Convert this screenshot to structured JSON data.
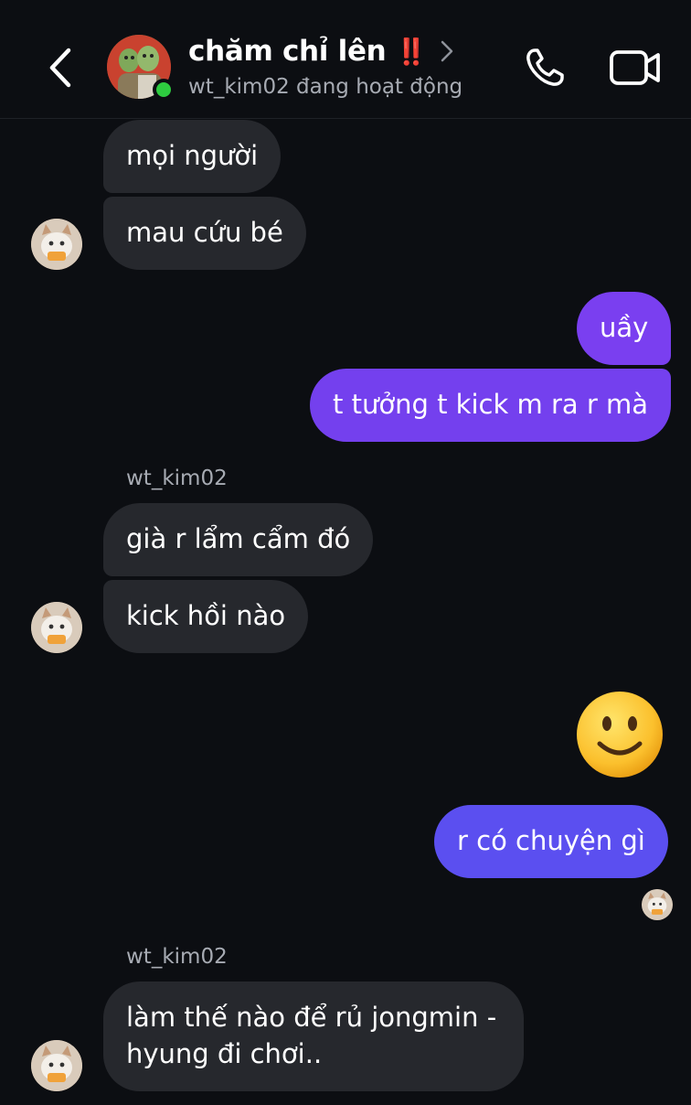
{
  "header": {
    "title": "chăm chỉ lên",
    "title_emoji": "‼️",
    "subtitle": "wt_kim02 đang hoạt động"
  },
  "messages": {
    "m1": "mọi người",
    "m2": "mau cứu bé",
    "m3": "uầy",
    "m4": "t tưởng t kick m ra r mà",
    "name1": "wt_kim02",
    "m5": "già r lẩm cẩm đó",
    "m6": "kick hồi nào",
    "m7_emoji": "🙂",
    "m8": "r có chuyện gì",
    "name2": "wt_kim02",
    "m9_line1": "làm thế nào để rủ jongmin -",
    "m9_line2": "hyung đi chơi.."
  },
  "colors": {
    "background": "#0c0e12",
    "incoming_bubble": "#26282d",
    "outgoing_purple": "#7a3ff0",
    "outgoing_blue": "#5b4ff0",
    "online": "#2ecc40"
  }
}
